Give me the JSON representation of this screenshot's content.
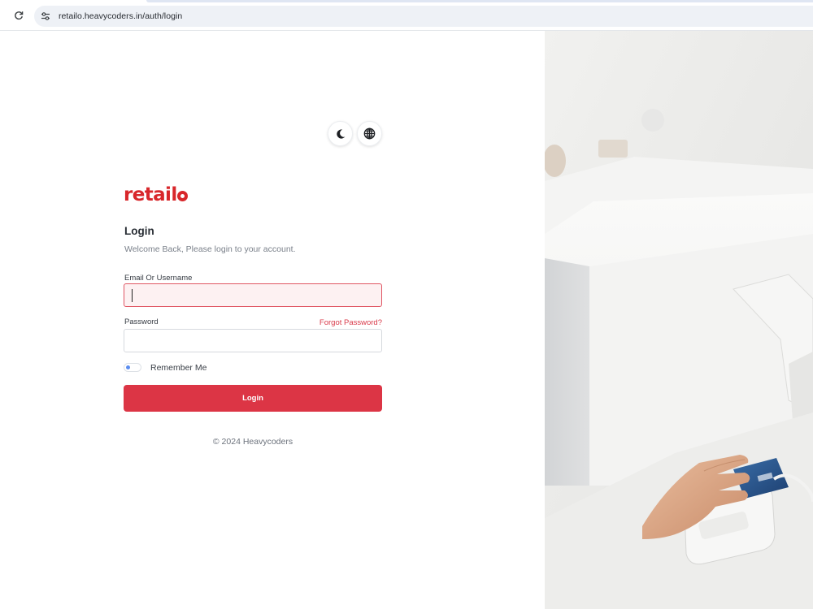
{
  "browser": {
    "url": "retailo.heavycoders.in/auth/login"
  },
  "login": {
    "brand": "retail",
    "title": "Login",
    "subtitle": "Welcome Back, Please login to your account.",
    "email_label": "Email Or Username",
    "email_value": "",
    "password_label": "Password",
    "password_value": "",
    "forgot_password": "Forgot Password?",
    "remember_me": "Remember Me",
    "remember_checked": false,
    "submit_label": "Login",
    "footer": "© 2024 Heavycoders"
  },
  "colors": {
    "brand": "#d8272b",
    "primary_button": "#dc3545",
    "link": "#d93a4a",
    "error_border": "#e05563"
  },
  "icons": {
    "theme": "moon-icon",
    "language": "globe-icon",
    "reload": "reload-icon",
    "site_info": "tune-icon"
  }
}
